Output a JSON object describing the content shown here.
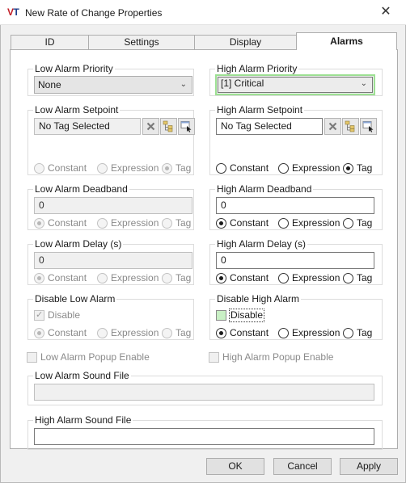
{
  "window": {
    "title": "New Rate of Change Properties",
    "logo_v": "V",
    "logo_t": "T",
    "close_glyph": "✕"
  },
  "tabs": [
    {
      "label": "ID"
    },
    {
      "label": "Settings"
    },
    {
      "label": "Display"
    },
    {
      "label": "Alarms"
    }
  ],
  "active_tab": "Alarms",
  "low": {
    "priority": {
      "label": "Low Alarm Priority",
      "value": "None"
    },
    "setpoint": {
      "label": "Low Alarm Setpoint",
      "value": "No Tag Selected",
      "mode": "Tag"
    },
    "deadband": {
      "label": "Low Alarm Deadband",
      "value": "0",
      "mode": "Constant"
    },
    "delay": {
      "label": "Low Alarm Delay (s)",
      "value": "0",
      "mode": "Constant"
    },
    "disable": {
      "label": "Disable Low Alarm",
      "checkbox_label": "Disable",
      "checked": true,
      "mode": "Constant"
    },
    "popup": {
      "label": "Low Alarm Popup Enable",
      "checked": false
    },
    "sound_file": {
      "label": "Low Alarm Sound File",
      "value": ""
    }
  },
  "high": {
    "priority": {
      "label": "High Alarm Priority",
      "value": "[1] Critical"
    },
    "setpoint": {
      "label": "High Alarm Setpoint",
      "value": "No Tag Selected",
      "mode": "Tag"
    },
    "deadband": {
      "label": "High Alarm Deadband",
      "value": "0",
      "mode": "Constant"
    },
    "delay": {
      "label": "High Alarm Delay (s)",
      "value": "0",
      "mode": "Constant"
    },
    "disable": {
      "label": "Disable High Alarm",
      "checkbox_label": "Disable",
      "checked": false,
      "mode": "Constant"
    },
    "popup": {
      "label": "High Alarm Popup Enable",
      "checked": false
    },
    "sound_file": {
      "label": "High Alarm Sound File",
      "value": ""
    }
  },
  "mode_options": {
    "constant": "Constant",
    "expression": "Expression",
    "tag": "Tag"
  },
  "buttons": {
    "ok": "OK",
    "cancel": "Cancel",
    "apply": "Apply"
  },
  "colors": {
    "focus_green": "#9de093",
    "checkbox_green": "#c9f0c5",
    "logo_red": "#c21f27",
    "logo_blue": "#1f3d8a"
  }
}
